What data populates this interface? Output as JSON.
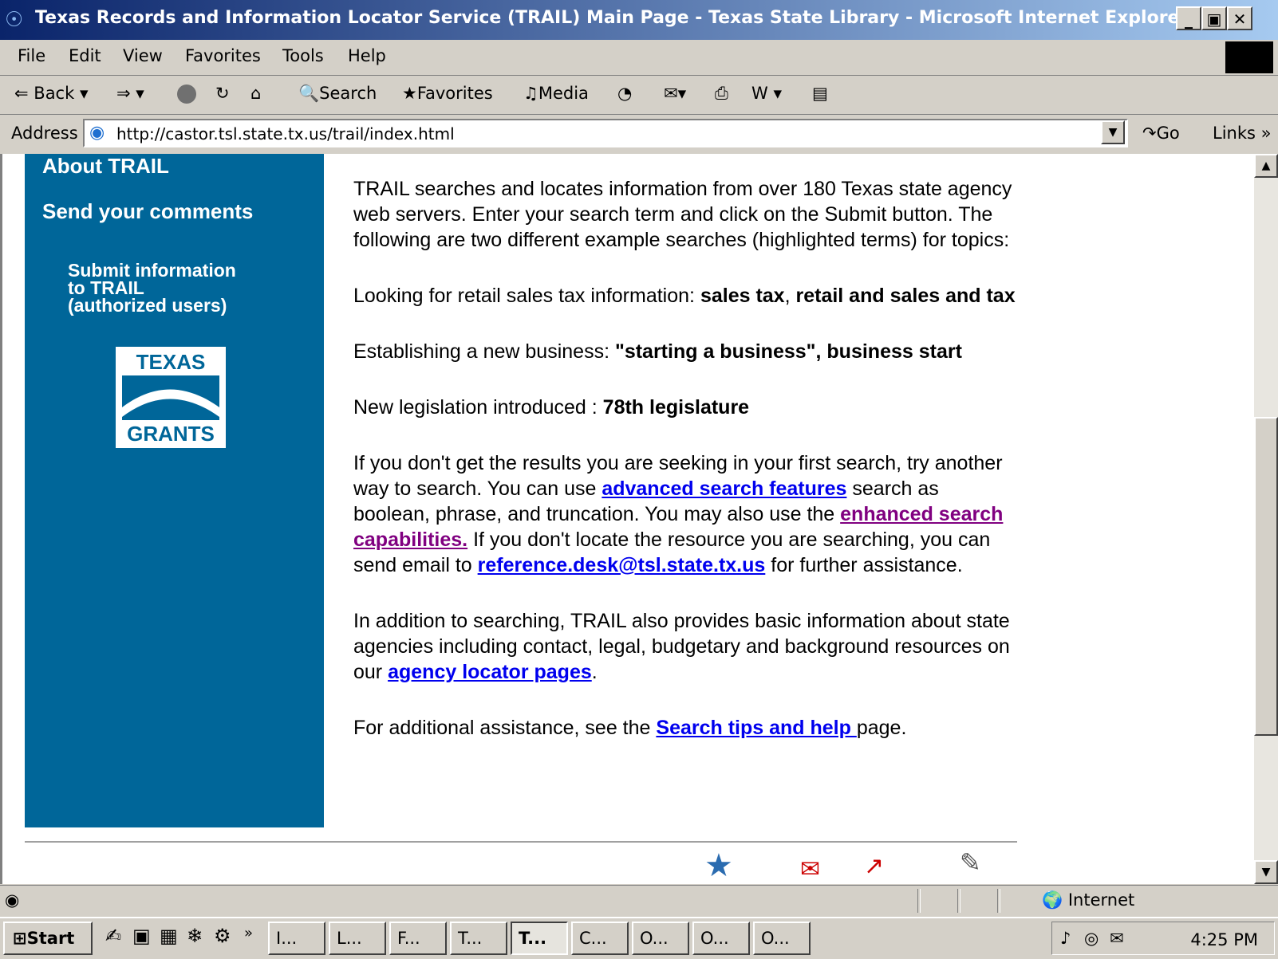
{
  "window": {
    "title": "Texas Records and Information Locator Service (TRAIL) Main Page - Texas State Library - Microsoft Internet Explorer",
    "minimize": "_",
    "restore": "▣",
    "close": "✕"
  },
  "menu": [
    "File",
    "Edit",
    "View",
    "Favorites",
    "Tools",
    "Help"
  ],
  "toolbar": {
    "back": "Back",
    "search": "Search",
    "favorites": "Favorites",
    "media": "Media"
  },
  "address": {
    "label": "Address",
    "url": "http://castor.tsl.state.tx.us/trail/index.html",
    "go": "Go",
    "links": "Links"
  },
  "sidebar": {
    "about": "About TRAIL",
    "comments": "Send your comments",
    "submit_line1": "Submit information",
    "submit_line2": "to TRAIL",
    "submit_line3": "(authorized users)",
    "logo_top": "TEXAS",
    "logo_bottom": "GRANTS"
  },
  "content": {
    "intro": "TRAIL searches and locates information from over 180 Texas state agency web servers. Enter your search term and click on the Submit button. The following are two different example searches (highlighted terms) for topics:",
    "ex1_label": "Looking for retail sales tax information: ",
    "ex1_terms_a": "sales tax",
    "ex1_sep": ", ",
    "ex1_terms_b": "retail and sales and tax",
    "ex2_label": "Establishing a new business: ",
    "ex2_terms": "\"starting a business\", business start",
    "ex3_label": "New legislation introduced : ",
    "ex3_terms": "78th legislature",
    "p4_a": "If you don't get the results you are seeking in your first search, try another way to search. You can use ",
    "p4_link1": "advanced search features",
    "p4_b": " search as boolean, phrase, and truncation. You may also use the ",
    "p4_link2": "enhanced search capabilities.",
    "p4_c": " If you don't locate the resource you are searching, you can send email to ",
    "p4_email": "reference.desk@tsl.state.tx.us",
    "p4_d": " for further assistance.",
    "p5_a": "In addition to searching, TRAIL also provides basic information about state agencies including contact, legal, budgetary and background resources on our ",
    "p5_link": "agency locator pages",
    "p5_b": ".",
    "p6_a": "For additional assistance, see the ",
    "p6_link": "Search tips and help ",
    "p6_b": "page."
  },
  "status": {
    "zone": "Internet"
  },
  "taskbar": {
    "start": "Start",
    "tasks": [
      "I...",
      "L...",
      "F...",
      "T...",
      "T...",
      "C...",
      "O...",
      "O...",
      "O..."
    ],
    "time": "4:25 PM"
  }
}
